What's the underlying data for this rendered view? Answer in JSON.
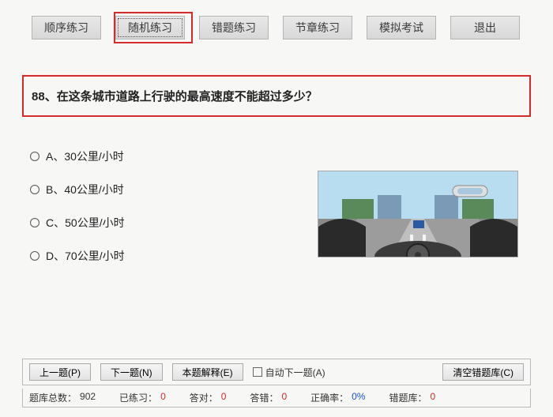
{
  "toolbar": {
    "tabs": [
      {
        "label": "顺序练习",
        "active": false
      },
      {
        "label": "随机练习",
        "active": true
      },
      {
        "label": "错题练习",
        "active": false
      },
      {
        "label": "节章练习",
        "active": false
      },
      {
        "label": "模拟考试",
        "active": false
      },
      {
        "label": "退出",
        "active": false
      }
    ]
  },
  "question": {
    "number": "88",
    "text": "在这条城市道路上行驶的最高速度不能超过多少？",
    "options": [
      {
        "key": "A",
        "text": "30公里/小时"
      },
      {
        "key": "B",
        "text": "40公里/小时"
      },
      {
        "key": "C",
        "text": "50公里/小时"
      },
      {
        "key": "D",
        "text": "70公里/小时"
      }
    ]
  },
  "controls": {
    "prev": "上一题(P)",
    "next": "下一题(N)",
    "explain": "本题解释(E)",
    "auto_next": "自动下一题(A)",
    "clear_wrong": "清空错题库(C)"
  },
  "stats": {
    "total_label": "题库总数：",
    "total_value": "902",
    "practiced_label": "已练习：",
    "practiced_value": "0",
    "correct_label": "答对：",
    "correct_value": "0",
    "wrong_label": "答错：",
    "wrong_value": "0",
    "rate_label": "正确率：",
    "rate_value": "0%",
    "wrongdb_label": "错题库：",
    "wrongdb_value": "0"
  }
}
